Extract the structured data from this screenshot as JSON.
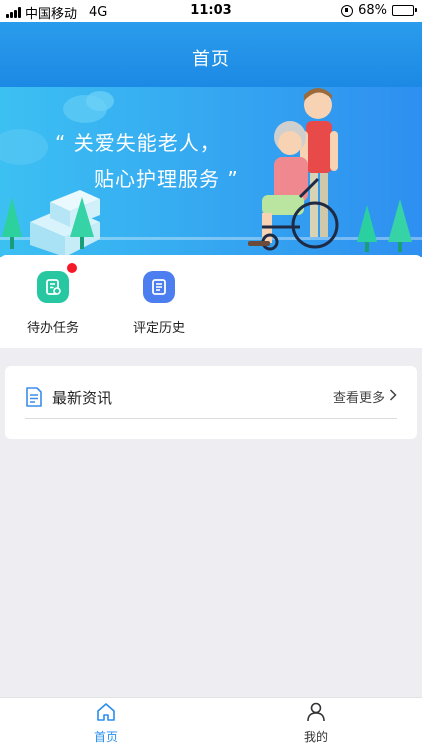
{
  "status_bar": {
    "carrier": "中国移动",
    "network": "4G",
    "time": "11:03",
    "battery_percent": "68%",
    "battery_level": 0.68
  },
  "nav": {
    "title": "首页"
  },
  "banner": {
    "line1": "“ 关爱失能老人，",
    "line2": "贴心护理服务 ”"
  },
  "quick_actions": [
    {
      "label": "待办任务",
      "icon": "todo-task-icon",
      "color": "#27c7a1",
      "has_badge": true
    },
    {
      "label": "评定历史",
      "icon": "assessment-history-icon",
      "color": "#4c7ef0",
      "has_badge": false
    }
  ],
  "news": {
    "title": "最新资讯",
    "more_label": "查看更多",
    "icon": "document-icon",
    "icon_color": "#3a8ee8"
  },
  "tabbar": {
    "tabs": [
      {
        "label": "首页",
        "icon": "home-icon",
        "active": true
      },
      {
        "label": "我的",
        "icon": "user-icon",
        "active": false
      }
    ],
    "active_color": "#2a8ef0",
    "inactive_color": "#333333"
  },
  "colors": {
    "nav_blue": "#1f8fe6",
    "badge_red": "#f5192a",
    "background": "#eeeef2"
  }
}
